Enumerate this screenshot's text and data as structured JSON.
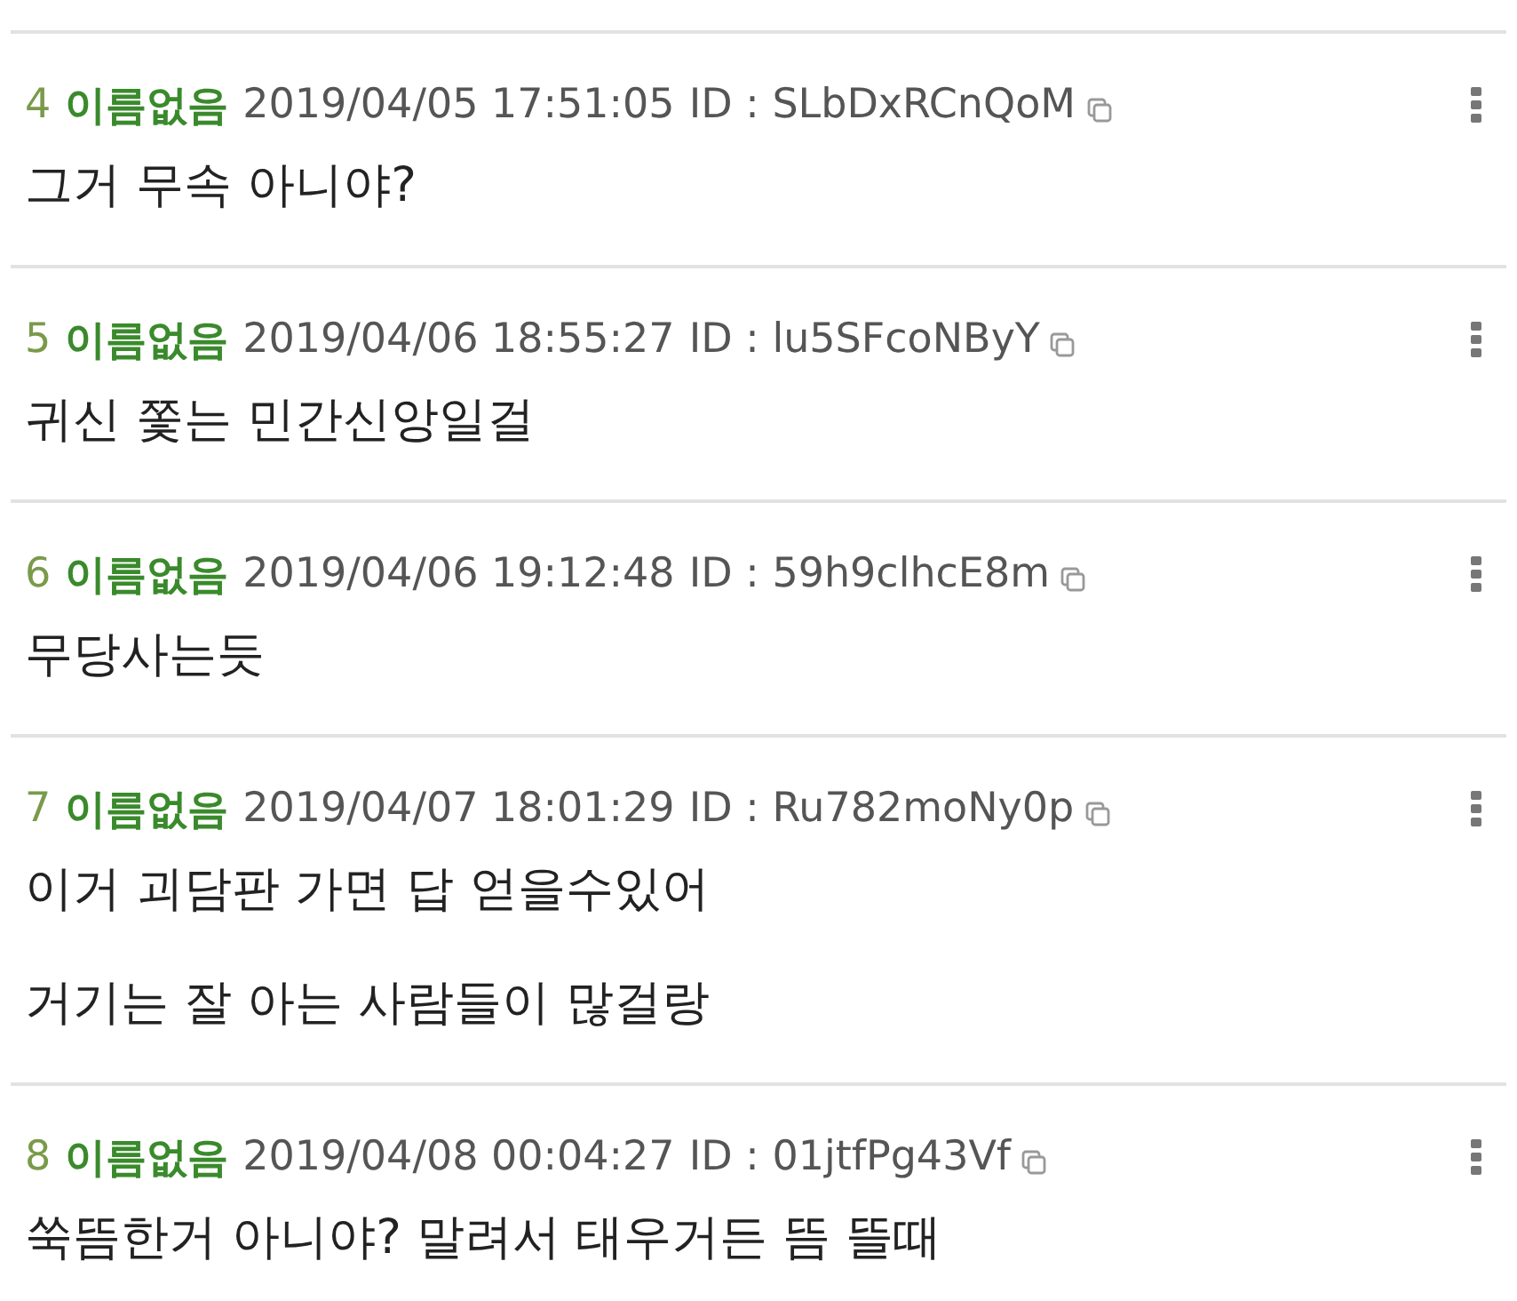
{
  "posts": [
    {
      "number": "4",
      "name": "이름없음",
      "date": "2019/04/05 17:51:05",
      "id": "ID : SLbDxRCnQoM",
      "lines": [
        "그거 무속 아니야?"
      ]
    },
    {
      "number": "5",
      "name": "이름없음",
      "date": "2019/04/06 18:55:27",
      "id": "ID : lu5SFcoNByY",
      "lines": [
        "귀신 쫓는 민간신앙일걸"
      ]
    },
    {
      "number": "6",
      "name": "이름없음",
      "date": "2019/04/06 19:12:48",
      "id": "ID : 59h9clhcE8m",
      "lines": [
        "무당사는듯"
      ]
    },
    {
      "number": "7",
      "name": "이름없음",
      "date": "2019/04/07 18:01:29",
      "id": "ID : Ru782moNy0p",
      "lines": [
        "이거 괴담판 가면 답 얻을수있어",
        "거기는 잘 아는 사람들이 많걸랑"
      ]
    },
    {
      "number": "8",
      "name": "이름없음",
      "date": "2019/04/08 00:04:27",
      "id": "ID : 01jtfPg43Vf",
      "lines": [
        "쑥뜸한거 아니야? 말려서 태우거든 뜸 뜰때"
      ]
    }
  ]
}
